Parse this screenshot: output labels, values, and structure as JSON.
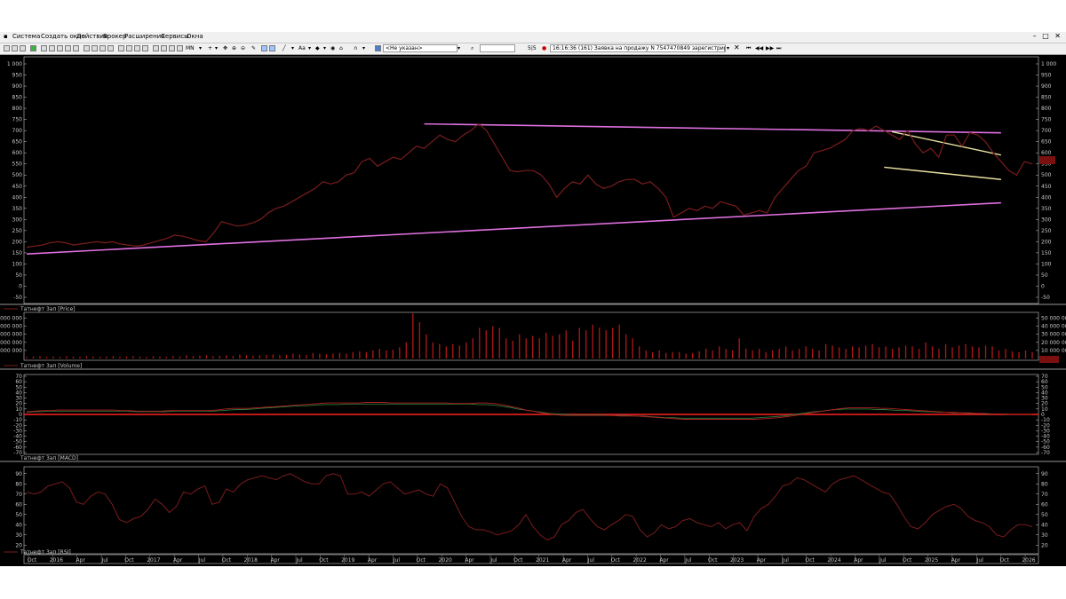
{
  "menu": [
    "Система",
    "Создать окно",
    "Действия",
    "Брокер",
    "Расширения",
    "Сервисы",
    "Окна"
  ],
  "toolbar": {
    "timeframe": "MN",
    "font_label": "Аа",
    "account": "<Не указан>",
    "counter": "5|5",
    "message": "16:16:36 (161) Заявка на продажу N 7547470849 зарегистрирована."
  },
  "colors": {
    "price": "#7a1c1c",
    "trend": "#e070e0",
    "channel": "#e8e0a0",
    "macd": "#b02020",
    "signal": "#2e7a3a",
    "zero": "#ff2020",
    "frame": "#c8c8c8",
    "badge": "#7a1010"
  },
  "chart_data": [
    {
      "type": "line",
      "panel": "price",
      "title": "Татнефт 3ап [Price]",
      "ylim": [
        -50,
        1000
      ],
      "yticks": [
        "1 000",
        "950",
        "900",
        "850",
        "800",
        "750",
        "700",
        "650",
        "600",
        "550",
        "500",
        "450",
        "400",
        "350",
        "300",
        "250",
        "200",
        "150",
        "100",
        "50",
        "0",
        "-50"
      ],
      "x": [
        "2015-07",
        "2015-08",
        "2015-09",
        "2015-10",
        "2015-11",
        "2015-12",
        "2016-01",
        "2016-02",
        "2016-03",
        "2016-04",
        "2016-05",
        "2016-06",
        "2016-07",
        "2016-08",
        "2016-09",
        "2016-10",
        "2016-11",
        "2016-12",
        "2017-01",
        "2017-02",
        "2017-03",
        "2017-04",
        "2017-05",
        "2017-06",
        "2017-07",
        "2017-08",
        "2017-09",
        "2017-10",
        "2017-11",
        "2017-12",
        "2018-01",
        "2018-02",
        "2018-03",
        "2018-04",
        "2018-05",
        "2018-06",
        "2018-07",
        "2018-08",
        "2018-09",
        "2018-10",
        "2018-11",
        "2018-12",
        "2019-01",
        "2019-02",
        "2019-03",
        "2019-04",
        "2019-05",
        "2019-06",
        "2019-07",
        "2019-08",
        "2019-09",
        "2019-10",
        "2019-11",
        "2019-12",
        "2020-01",
        "2020-02",
        "2020-03",
        "2020-04",
        "2020-05",
        "2020-06",
        "2020-07",
        "2020-08",
        "2020-09",
        "2020-10",
        "2020-11",
        "2020-12",
        "2021-01",
        "2021-02",
        "2021-03",
        "2021-04",
        "2021-05",
        "2021-06",
        "2021-07",
        "2021-08",
        "2021-09",
        "2021-10",
        "2021-11",
        "2021-12",
        "2022-01",
        "2022-02",
        "2022-03",
        "2022-04",
        "2022-05",
        "2022-06",
        "2022-07",
        "2022-08",
        "2022-09",
        "2022-10",
        "2022-11",
        "2022-12",
        "2023-01",
        "2023-02",
        "2023-03",
        "2023-04",
        "2023-05",
        "2023-06",
        "2023-07",
        "2023-08",
        "2023-09",
        "2023-10",
        "2023-11",
        "2023-12",
        "2024-01",
        "2024-02",
        "2024-03",
        "2024-04",
        "2024-05",
        "2024-06",
        "2024-07",
        "2024-08",
        "2024-09",
        "2024-10",
        "2024-11",
        "2024-12",
        "2025-01",
        "2025-02",
        "2025-03",
        "2025-04",
        "2025-05",
        "2025-06",
        "2025-07",
        "2025-08",
        "2025-09",
        "2025-10",
        "2025-11",
        "2025-12"
      ],
      "series": [
        {
          "values": [
            175,
            180,
            185,
            195,
            200,
            195,
            185,
            190,
            195,
            200,
            195,
            200,
            190,
            185,
            180,
            185,
            195,
            205,
            215,
            230,
            225,
            215,
            205,
            200,
            240,
            290,
            280,
            270,
            275,
            285,
            300,
            330,
            350,
            360,
            380,
            400,
            420,
            440,
            470,
            460,
            470,
            500,
            510,
            560,
            575,
            540,
            560,
            580,
            570,
            600,
            630,
            620,
            650,
            680,
            660,
            650,
            680,
            700,
            730,
            700,
            640,
            580,
            520,
            515,
            520,
            520,
            500,
            460,
            400,
            440,
            470,
            460,
            500,
            460,
            440,
            450,
            470,
            480,
            480,
            460,
            470,
            440,
            400,
            310,
            330,
            350,
            340,
            360,
            350,
            380,
            370,
            360,
            320,
            330,
            340,
            330,
            400,
            440,
            480,
            520,
            540,
            600,
            610,
            620,
            640,
            660,
            700,
            710,
            700,
            720,
            700,
            680,
            660,
            700,
            640,
            600,
            620,
            580,
            680,
            680,
            630,
            690,
            680,
            650,
            600,
            560,
            520,
            500,
            560,
            550
          ]
        }
      ],
      "trendlines": [
        {
          "name": "",
          "points": [
            [
              "2015-07",
              145
            ],
            [
              "2025-12",
              375
            ]
          ]
        },
        {
          "name": "",
          "points": [
            [
              "2019-10",
              730
            ],
            [
              "2025-12",
              690
            ]
          ]
        },
        {
          "name": "",
          "points": [
            [
              "2024-10",
              695
            ],
            [
              "2025-12",
              590
            ]
          ]
        },
        {
          "name": "",
          "points": [
            [
              "2024-09",
              535
            ],
            [
              "2025-12",
              480
            ]
          ]
        }
      ],
      "last_value_badge": ""
    },
    {
      "type": "bar",
      "panel": "volume",
      "title": "Татнефт 3ап [Volume]",
      "ylim": [
        0,
        55000000
      ],
      "yticks": [
        "50 000 000",
        "40 000 000",
        "30 000 000",
        "20 000 000",
        "10 000 000"
      ],
      "series": [
        {
          "values": [
            2000000,
            2500000,
            3000000,
            2000000,
            2500000,
            2000000,
            3000000,
            2500000,
            2000000,
            3000000,
            2500000,
            2000000,
            2500000,
            3000000,
            2000000,
            2500000,
            3000000,
            2500000,
            2000000,
            3000000,
            2500000,
            2000000,
            3000000,
            2500000,
            4000000,
            3000000,
            3500000,
            4000000,
            3000000,
            3500000,
            4000000,
            3000000,
            5000000,
            4000000,
            3500000,
            4000000,
            4500000,
            5000000,
            4000000,
            4500000,
            6000000,
            5000000,
            4500000,
            7000000,
            6000000,
            5000000,
            6000000,
            7000000,
            6000000,
            8000000,
            9000000,
            8000000,
            10000000,
            12000000,
            10000000,
            11000000,
            14000000,
            20000000,
            56000000,
            45000000,
            30000000,
            20000000,
            18000000,
            15000000,
            18000000,
            16000000,
            20000000,
            25000000,
            38000000,
            35000000,
            40000000,
            38000000,
            25000000,
            22000000,
            30000000,
            25000000,
            28000000,
            25000000,
            32000000,
            28000000,
            30000000,
            35000000,
            22000000,
            38000000,
            35000000,
            42000000,
            38000000,
            35000000,
            38000000,
            42000000,
            30000000,
            25000000,
            15000000,
            10000000,
            8000000,
            10000000,
            7000000,
            8000000,
            8000000,
            6000000,
            7000000,
            9000000,
            12000000,
            10000000,
            15000000,
            12000000,
            10000000,
            25000000,
            12000000,
            10000000,
            12000000,
            8000000,
            10000000,
            12000000,
            15000000,
            10000000,
            12000000,
            15000000,
            12000000,
            10000000,
            18000000,
            16000000,
            14000000,
            12000000,
            15000000,
            14000000,
            16000000,
            18000000,
            14000000,
            15000000,
            12000000,
            14000000,
            16000000,
            15000000,
            12000000,
            20000000,
            15000000,
            12000000,
            18000000,
            14000000,
            16000000,
            18000000,
            15000000,
            14000000,
            16000000,
            15000000,
            10000000,
            12000000,
            9000000,
            8000000,
            10000000,
            8000000
          ]
        }
      ],
      "last_value_badge": ""
    },
    {
      "type": "line",
      "panel": "macd",
      "title": "Татнефт 3ап [MACD]",
      "ylim": [
        -70,
        70
      ],
      "yticks": [
        "70",
        "60",
        "50",
        "40",
        "30",
        "20",
        "10",
        "0",
        "-10",
        "-20",
        "-30",
        "-40",
        "-50",
        "-60",
        "-70"
      ],
      "series": [
        {
          "values": [
            5,
            6,
            7,
            7,
            8,
            8,
            8,
            8,
            8,
            8,
            8,
            8,
            7,
            7,
            6,
            6,
            6,
            6,
            7,
            7,
            7,
            7,
            7,
            7,
            8,
            10,
            11,
            11,
            11,
            12,
            13,
            14,
            15,
            16,
            17,
            18,
            19,
            20,
            21,
            21,
            21,
            21,
            21,
            22,
            22,
            22,
            21,
            21,
            21,
            21,
            21,
            21,
            21,
            21,
            20,
            20,
            20,
            21,
            21,
            20,
            18,
            15,
            12,
            8,
            6,
            3,
            1,
            -1,
            -2,
            -2,
            -2,
            -2,
            -2,
            -2,
            -2,
            -3,
            -3,
            -3,
            -4,
            -5,
            -6,
            -7,
            -8,
            -9,
            -9,
            -9,
            -9,
            -9,
            -9,
            -9,
            -9,
            -9,
            -9,
            -8,
            -7,
            -6,
            -4,
            -2,
            0,
            3,
            5,
            7,
            9,
            11,
            12,
            12,
            12,
            12,
            11,
            11,
            10,
            9,
            8,
            7,
            6,
            5,
            4,
            4,
            3,
            3,
            2,
            2,
            1,
            1,
            0,
            0,
            0,
            0
          ]
        },
        {
          "values": [
            4,
            5,
            5,
            6,
            6,
            6,
            6,
            6,
            6,
            6,
            6,
            6,
            6,
            6,
            5,
            5,
            5,
            5,
            5,
            6,
            6,
            6,
            6,
            6,
            6,
            7,
            8,
            9,
            9,
            10,
            11,
            12,
            13,
            14,
            15,
            16,
            16,
            17,
            18,
            18,
            18,
            19,
            19,
            19,
            19,
            19,
            19,
            19,
            19,
            19,
            19,
            19,
            19,
            19,
            19,
            19,
            19,
            19,
            18,
            18,
            17,
            15,
            13,
            10,
            8,
            6,
            4,
            2,
            1,
            0,
            -1,
            -1,
            -1,
            -1,
            -1,
            -2,
            -2,
            -2,
            -3,
            -3,
            -4,
            -5,
            -6,
            -6,
            -7,
            -7,
            -7,
            -7,
            -7,
            -7,
            -7,
            -7,
            -7,
            -7,
            -6,
            -5,
            -4,
            -3,
            -1,
            1,
            3,
            5,
            6,
            8,
            9,
            10,
            10,
            10,
            10,
            9,
            9,
            8,
            7,
            7,
            6,
            5,
            5,
            4,
            4,
            3,
            3,
            2,
            2,
            1,
            1,
            1,
            0,
            0,
            0,
            0
          ]
        }
      ],
      "zero_line": 0
    },
    {
      "type": "line",
      "panel": "rsi",
      "title": "Татнефт 3ап [RSI]",
      "ylim": [
        15,
        95
      ],
      "yticks": [
        "90",
        "80",
        "70",
        "60",
        "50",
        "40",
        "30",
        "20"
      ],
      "series": [
        {
          "values": [
            72,
            70,
            72,
            78,
            80,
            82,
            76,
            62,
            60,
            68,
            72,
            70,
            60,
            45,
            42,
            46,
            48,
            55,
            65,
            60,
            52,
            58,
            72,
            70,
            75,
            78,
            60,
            62,
            75,
            72,
            80,
            84,
            86,
            88,
            86,
            84,
            88,
            90,
            86,
            82,
            80,
            80,
            88,
            90,
            88,
            70,
            70,
            72,
            68,
            74,
            80,
            82,
            76,
            70,
            72,
            74,
            70,
            68,
            80,
            76,
            62,
            48,
            38,
            35,
            35,
            33,
            30,
            32,
            34,
            40,
            50,
            38,
            30,
            25,
            28,
            40,
            44,
            52,
            55,
            46,
            38,
            35,
            40,
            44,
            50,
            48,
            35,
            28,
            32,
            40,
            36,
            38,
            44,
            46,
            42,
            40,
            38,
            42,
            36,
            40,
            42,
            34,
            48,
            56,
            60,
            68,
            78,
            80,
            86,
            84,
            80,
            76,
            72,
            80,
            84,
            86,
            88,
            84,
            80,
            76,
            72,
            70,
            60,
            48,
            38,
            36,
            42,
            50,
            54,
            58,
            60,
            56,
            48,
            44,
            42,
            38,
            30,
            28,
            35,
            40,
            40,
            38
          ]
        }
      ]
    }
  ],
  "x_axis": {
    "labels": [
      "Oct",
      "2016",
      "Apr",
      "Jul",
      "Oct",
      "2017",
      "Apr",
      "Jul",
      "Oct",
      "2018",
      "Apr",
      "Jul",
      "Oct",
      "2019",
      "Apr",
      "Jul",
      "Oct",
      "2020",
      "Apr",
      "Jul",
      "Oct",
      "2021",
      "Apr",
      "Jul",
      "Oct",
      "2022",
      "Apr",
      "Jul",
      "Oct",
      "2023",
      "Apr",
      "Jul",
      "Oct",
      "2024",
      "Apr",
      "Jul",
      "Oct",
      "2025",
      "Apr",
      "Jul",
      "Oct",
      "2026"
    ]
  }
}
